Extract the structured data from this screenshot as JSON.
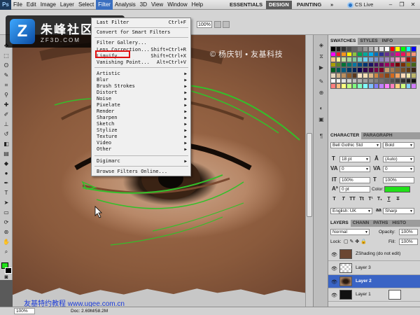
{
  "menubar": {
    "logo": "Ps",
    "items": [
      "File",
      "Edit",
      "Image",
      "Layer",
      "Select",
      "Filter",
      "Analysis",
      "3D",
      "View",
      "Window",
      "Help"
    ],
    "workspaces": {
      "essentials": "ESSENTIALS",
      "design": "DESIGN",
      "painting": "PAINTING",
      "more": "»"
    },
    "cslive": "CS Live"
  },
  "optbar": {
    "zoom": "100%"
  },
  "logo": {
    "mark": "Z",
    "name": "朱峰社区",
    "url": "ZF3D.COM"
  },
  "watermark": {
    "top": "© 杨庆钊 • 友基科技",
    "bottom": "友基特约教程  www.ugee.com.cn"
  },
  "filter_menu": {
    "last_filter": {
      "label": "Last Filter",
      "shortcut": "Ctrl+F"
    },
    "smart": "Convert for Smart Filters",
    "items_top": [
      {
        "label": "Filter Gallery...",
        "shortcut": ""
      },
      {
        "label": "Lens Correction...",
        "shortcut": "Shift+Ctrl+R"
      },
      {
        "label": "Liquify...",
        "shortcut": "Shift+Ctrl+X"
      },
      {
        "label": "Vanishing Point...",
        "shortcut": "Alt+Ctrl+V"
      }
    ],
    "submenus": [
      "Artistic",
      "Blur",
      "Brush Strokes",
      "Distort",
      "Noise",
      "Pixelate",
      "Render",
      "Sharpen",
      "Sketch",
      "Stylize",
      "Texture",
      "Video",
      "Other"
    ],
    "digimarc": "Digimarc",
    "browse": "Browse Filters Online..."
  },
  "swatches_tabs": [
    "SWATCHES",
    "STYLES",
    "INFO"
  ],
  "swatch_colors": [
    "#000000",
    "#1a1a1a",
    "#333333",
    "#4d4d4d",
    "#666666",
    "#808080",
    "#999999",
    "#b3b3b3",
    "#cccccc",
    "#e6e6e6",
    "#ffffff",
    "#ff0000",
    "#ffff00",
    "#00ff00",
    "#00ffff",
    "#0000ff",
    "#ff00ff",
    "#ed1c24",
    "#f7941d",
    "#fff200",
    "#8dc63f",
    "#00a651",
    "#00a99d",
    "#00aeef",
    "#0072bc",
    "#2e3192",
    "#662d91",
    "#92278f",
    "#ec008c",
    "#ed145b",
    "#f26c4f",
    "#f7977a",
    "#fdc689",
    "#fff799",
    "#c4df9b",
    "#a3d39c",
    "#82ca9c",
    "#7bcdc8",
    "#6ecff6",
    "#7ea7d8",
    "#8393ca",
    "#8781bd",
    "#a186be",
    "#bd8cbf",
    "#f49ac1",
    "#f6989d",
    "#9e0b0f",
    "#a0410d",
    "#aba000",
    "#598527",
    "#007236",
    "#00746b",
    "#0076a3",
    "#004a80",
    "#003471",
    "#1b1464",
    "#440e62",
    "#630460",
    "#9e005d",
    "#9e0039",
    "#790000",
    "#7b2e00",
    "#827b00",
    "#406618",
    "#005e20",
    "#005952",
    "#005b7f",
    "#003663",
    "#002157",
    "#0d004c",
    "#32004b",
    "#4b0049",
    "#7b0046",
    "#7a0026",
    "#c69c6d",
    "#a67c52",
    "#8c6239",
    "#754c24",
    "#603913",
    "#3c2415",
    "#e8d8c0",
    "#d2b48c",
    "#bc8f5f",
    "#8b5a2b",
    "#5c3a1e",
    "#ffe4c4",
    "#f5deb3",
    "#deb887",
    "#cd853f",
    "#a0522d",
    "#8b4513",
    "#d2691e",
    "#f4a460",
    "#ffdab9",
    "#eee8aa",
    "#bdb76b",
    "#ffffff",
    "#f2f2f2",
    "#e0e0e0",
    "#d0d0d0",
    "#c0c0c0",
    "#b0b0b0",
    "#a0a0a0",
    "#909090",
    "#808080",
    "#707070",
    "#606060",
    "#505050",
    "#404040",
    "#303030",
    "#202020",
    "#101010",
    "#ff7f7f",
    "#ffbf7f",
    "#ffff7f",
    "#bfff7f",
    "#7fff7f",
    "#7fffbf",
    "#7fffff",
    "#7fbfff",
    "#7f7fff",
    "#bf7fff",
    "#ff7fff",
    "#ff7fbf",
    "#ffd27f",
    "#d2ff7f",
    "#7fd2ff",
    "#d27fff"
  ],
  "character": {
    "tabs": [
      "CHARACTER",
      "PARAGRAPH"
    ],
    "font": "Bell Gothic Std",
    "style": "Bold",
    "size": "18 pt",
    "leading": "(Auto)",
    "kerning": "0",
    "tracking": "0",
    "vscale": "100%",
    "hscale": "100%",
    "baseline": "0 pt",
    "color_label": "Color:",
    "color": "#22e01a",
    "language": "English: UK",
    "aa_label": "aa",
    "antialias": "Sharp",
    "tt_buttons": [
      "T",
      "T",
      "TT",
      "Tt",
      "T¹",
      "T₁",
      "T",
      "T"
    ]
  },
  "layers": {
    "tabs": [
      "LAYERS",
      "CHANN",
      "PATHS",
      "HISTO"
    ],
    "blend": "Normal",
    "opacity_label": "Opacity:",
    "opacity": "100%",
    "lock_label": "Lock:",
    "fill_label": "Fill:",
    "fill": "100%",
    "items": [
      {
        "name": "ZShading (do not edit)",
        "selected": false
      },
      {
        "name": "Layer 3",
        "selected": false
      },
      {
        "name": "Layer 2",
        "selected": true
      },
      {
        "name": "Layer 1",
        "selected": false
      }
    ]
  },
  "status": {
    "zoom": "100%",
    "doc": "Doc: 2.69M/58.2M"
  }
}
